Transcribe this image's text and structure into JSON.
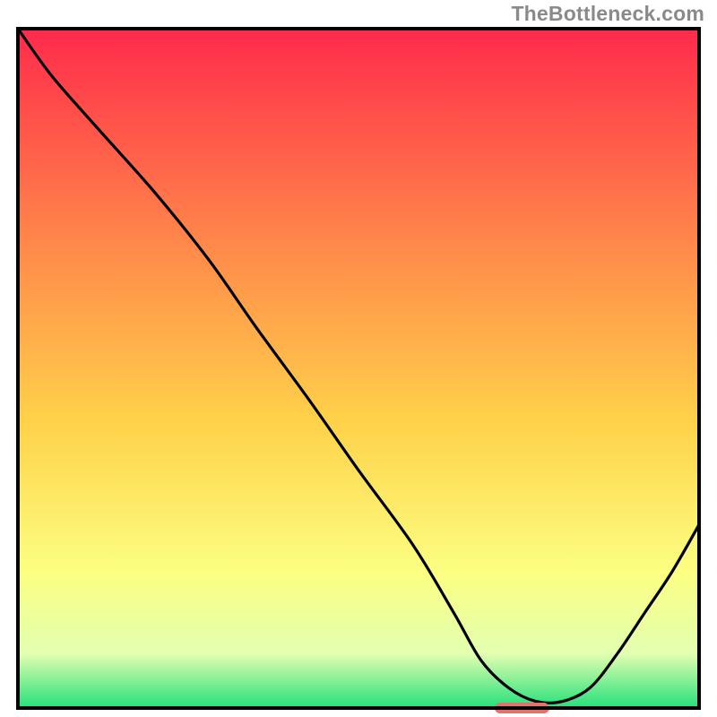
{
  "watermark": "TheBottleneck.com",
  "chart_data": {
    "type": "line",
    "title": "",
    "xlabel": "",
    "ylabel": "",
    "xlim": [
      0,
      100
    ],
    "ylim": [
      0,
      100
    ],
    "grid": false,
    "legend": false,
    "annotations": [],
    "series": [
      {
        "name": "curve",
        "x": [
          0,
          5,
          12,
          20,
          28,
          35,
          43,
          50,
          58,
          64,
          68,
          72,
          76,
          80,
          84,
          88,
          92,
          96,
          100
        ],
        "y": [
          100,
          93,
          85,
          76,
          66,
          56,
          45,
          35,
          24,
          14,
          7,
          3,
          1,
          1,
          3,
          8,
          14,
          20,
          27
        ]
      }
    ],
    "baseline_marker": {
      "x_start": 70,
      "x_end": 78,
      "y": 0,
      "color": "#e4706f"
    },
    "background_gradient": {
      "top": "#ff2a4b",
      "mid1": "#ff894a",
      "mid2": "#ffd24a",
      "mid3": "#fcff82",
      "mid4": "#e2ffb1",
      "bottom": "#24e07b"
    },
    "frame_color": "#000000",
    "curve_color": "#000000"
  }
}
